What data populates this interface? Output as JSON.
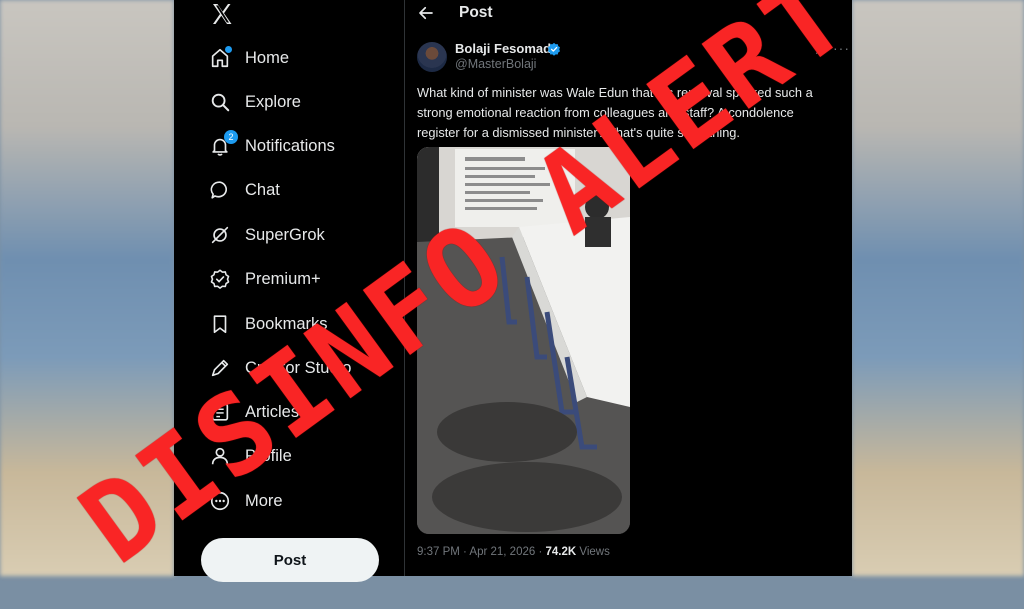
{
  "nav": {
    "items": [
      {
        "label": "Home",
        "icon": "home-icon"
      },
      {
        "label": "Explore",
        "icon": "search-icon"
      },
      {
        "label": "Notifications",
        "icon": "bell-icon",
        "badge": "2"
      },
      {
        "label": "Chat",
        "icon": "chat-bubble-icon"
      },
      {
        "label": "SuperGrok",
        "icon": "grok-icon"
      },
      {
        "label": "Premium+",
        "icon": "premium-badge-icon"
      },
      {
        "label": "Bookmarks",
        "icon": "bookmark-icon"
      },
      {
        "label": "Creator Studio",
        "icon": "creator-studio-icon"
      },
      {
        "label": "Articles",
        "icon": "articles-icon"
      },
      {
        "label": "Profile",
        "icon": "person-icon"
      },
      {
        "label": "More",
        "icon": "more-circle-icon"
      }
    ],
    "post_button": "Post"
  },
  "header": {
    "title": "Post"
  },
  "tweet": {
    "author_name": "Bolaji Fesomade",
    "author_handle": "@MasterBolaji",
    "text": "What kind of minister was Wale Edun that his removal sparked such a strong emotional reaction from colleagues and staff? A condolence register for a dismissed minister? That's quite something.",
    "time": "9:37 PM · Apr 21, 2026 · ",
    "views_count": "74.2K",
    "views_label": " Views"
  },
  "overlay": {
    "stamp": "DISINFO ALERT"
  },
  "colors": {
    "accent": "#1d9bf0",
    "stamp": "#ff2828",
    "background": "#000000"
  }
}
